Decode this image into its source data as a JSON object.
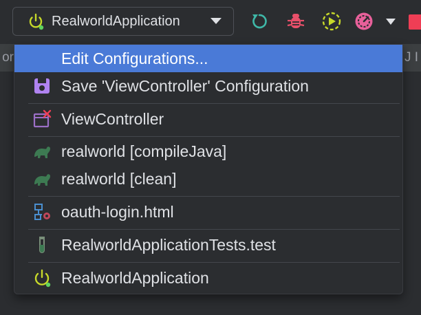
{
  "toolbar": {
    "run_config_label": "RealworldApplication",
    "icons": [
      "power-icon",
      "chevron-down-icon",
      "rerun-icon",
      "debug-bug-icon",
      "run-with-coverage-icon",
      "profiler-icon",
      "more-chevron-icon",
      "stop-icon"
    ]
  },
  "side": {
    "left_fragment": "or",
    "right_fragment": "J I"
  },
  "menu": {
    "items": [
      {
        "label": "Edit Configurations...",
        "icon": "none",
        "selected": true
      },
      {
        "label": "Save 'ViewController' Configuration",
        "icon": "save-icon"
      },
      {
        "label": "ViewController",
        "icon": "temporary-config-icon"
      },
      {
        "label": "realworld [compileJava]",
        "icon": "gradle-icon"
      },
      {
        "label": "realworld [clean]",
        "icon": "gradle-icon"
      },
      {
        "label": "oauth-login.html",
        "icon": "html-run-icon"
      },
      {
        "label": "RealworldApplicationTests.test",
        "icon": "test-tube-icon"
      },
      {
        "label": "RealworldApplication",
        "icon": "power-icon"
      }
    ]
  },
  "colors": {
    "selection": "#4a7ad7",
    "power": "#c7d92a",
    "running_dot": "#5fd35f",
    "rerun": "#3fb8a8",
    "debug": "#e8506a",
    "coverage": "#c7d92a",
    "profiler": "#e8609a",
    "stop": "#ef3e55",
    "save": "#b083f0",
    "gradle": "#3d7a52"
  }
}
